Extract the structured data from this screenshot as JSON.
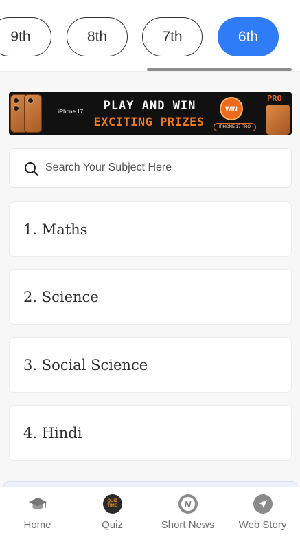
{
  "class_tabs": [
    {
      "label": "9th",
      "active": false
    },
    {
      "label": "8th",
      "active": false
    },
    {
      "label": "7th",
      "active": false
    },
    {
      "label": "6th",
      "active": true
    }
  ],
  "banner": {
    "device_label": "iPhone 17",
    "headline": "PLAY AND WIN",
    "subheadline": "EXCITING PRIZES",
    "badge": "WIN",
    "chip": "IPHONE 17 PRO",
    "pro_label": "PRO"
  },
  "search": {
    "placeholder": "Search Your Subject Here",
    "value": ""
  },
  "subjects": [
    {
      "label": "1. Maths"
    },
    {
      "label": "2. Science"
    },
    {
      "label": "3. Social Science"
    },
    {
      "label": "4. Hindi"
    }
  ],
  "bottom_nav": [
    {
      "label": "Home",
      "icon": "graduation-cap-icon"
    },
    {
      "label": "Quiz",
      "icon": "quiz-time-icon",
      "icon_text": "QUIZ TIME"
    },
    {
      "label": "Short News",
      "icon": "news-icon",
      "icon_text": "N"
    },
    {
      "label": "Web Story",
      "icon": "compass-icon"
    }
  ],
  "colors": {
    "accent": "#2f7cf6",
    "banner_orange": "#ec6a1c"
  }
}
